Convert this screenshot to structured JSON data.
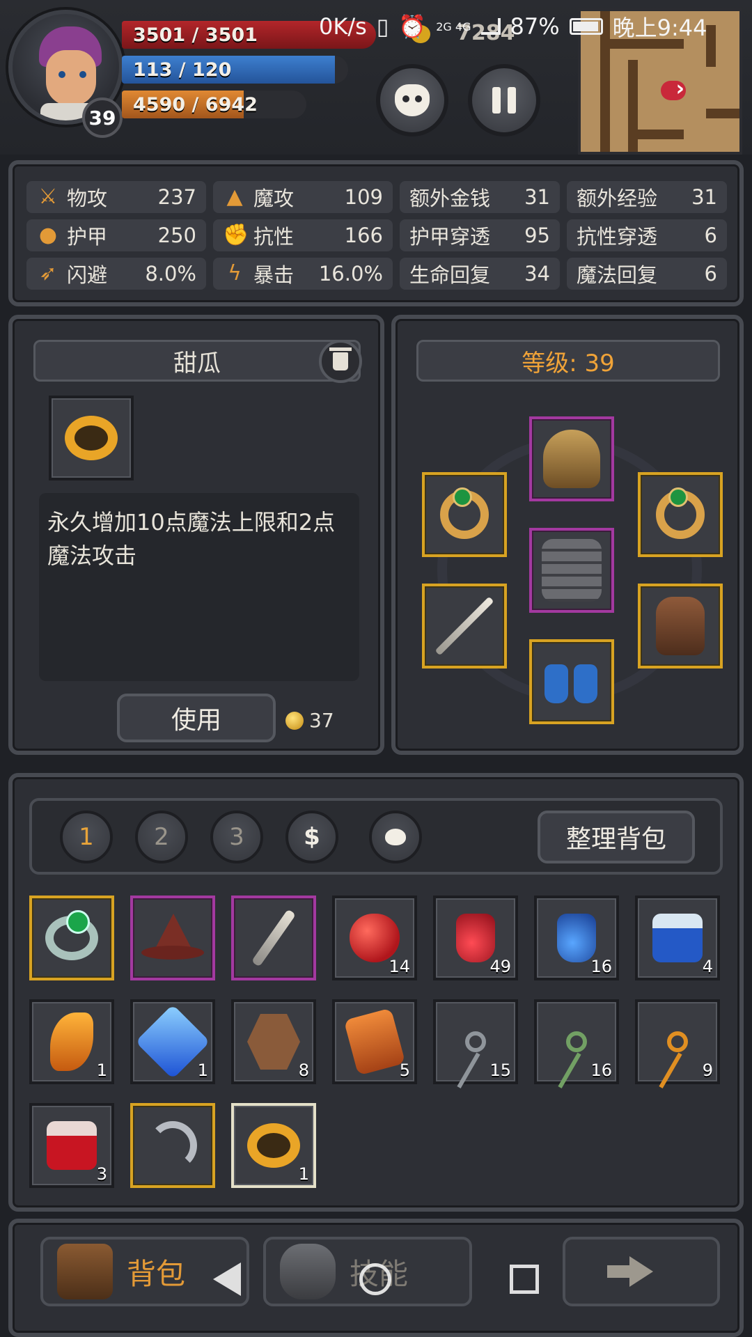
{
  "status_bar": {
    "net_speed": "0K/s",
    "network": "2G 4G",
    "battery": "87%",
    "time": "晚上9:44"
  },
  "hud": {
    "level": "39",
    "hp": "3501 / 3501",
    "mp": "113 / 120",
    "xp": "4590 / 6942",
    "hp_ratio": 1.0,
    "mp_ratio": 0.942,
    "xp_ratio": 0.661,
    "gold": "7284",
    "colors": {
      "hp": "#b3262a",
      "mp": "#3d7fcf",
      "xp": "#e08933",
      "accent": "#e39a37"
    }
  },
  "stats": [
    {
      "icon": "sword-icon",
      "label": "物攻",
      "value": "237"
    },
    {
      "icon": "magic-hat-icon",
      "label": "魔攻",
      "value": "109"
    },
    {
      "label": "额外金钱",
      "value": "31"
    },
    {
      "label": "额外经验",
      "value": "31"
    },
    {
      "icon": "paw-icon",
      "label": "护甲",
      "value": "250"
    },
    {
      "icon": "muscle-icon",
      "label": "抗性",
      "value": "166"
    },
    {
      "label": "护甲穿透",
      "value": "95"
    },
    {
      "label": "抗性穿透",
      "value": "6"
    },
    {
      "icon": "running-icon",
      "label": "闪避",
      "value": "8.0%"
    },
    {
      "icon": "lightning-icon",
      "label": "暴击",
      "value": "16.0%"
    },
    {
      "label": "生命回复",
      "value": "34"
    },
    {
      "label": "魔法回复",
      "value": "6"
    }
  ],
  "selected_item": {
    "name": "甜瓜",
    "description": "永久增加10点魔法上限和2点魔法攻击",
    "use_label": "使用",
    "price": "37"
  },
  "equipment": {
    "title": "等级: 39"
  },
  "inventory": {
    "tabs": [
      "1",
      "2",
      "3",
      "$"
    ],
    "sort_label": "整理背包",
    "items": [
      {
        "name": "green-gem-ring",
        "count": "",
        "rarity": "gold"
      },
      {
        "name": "wizard-hat",
        "count": "",
        "rarity": "purple"
      },
      {
        "name": "curved-dagger",
        "count": "",
        "rarity": "purple"
      },
      {
        "name": "apple",
        "count": "14",
        "rarity": ""
      },
      {
        "name": "red-potion",
        "count": "49",
        "rarity": ""
      },
      {
        "name": "blue-potion",
        "count": "16",
        "rarity": ""
      },
      {
        "name": "blue-jar",
        "count": "4",
        "rarity": ""
      },
      {
        "name": "orange-claw",
        "count": "1",
        "rarity": ""
      },
      {
        "name": "blue-gem",
        "count": "1",
        "rarity": ""
      },
      {
        "name": "stone-rune",
        "count": "8",
        "rarity": ""
      },
      {
        "name": "orange-rune",
        "count": "5",
        "rarity": ""
      },
      {
        "name": "silver-key",
        "count": "15",
        "rarity": ""
      },
      {
        "name": "green-key",
        "count": "16",
        "rarity": ""
      },
      {
        "name": "orange-key",
        "count": "9",
        "rarity": ""
      },
      {
        "name": "red-jar",
        "count": "3",
        "rarity": ""
      },
      {
        "name": "sickle",
        "count": "",
        "rarity": "gold"
      },
      {
        "name": "gold-ring",
        "count": "1",
        "rarity": "selected"
      }
    ]
  },
  "bottom_nav": {
    "bag_label": "背包",
    "skill_label": "技能"
  }
}
